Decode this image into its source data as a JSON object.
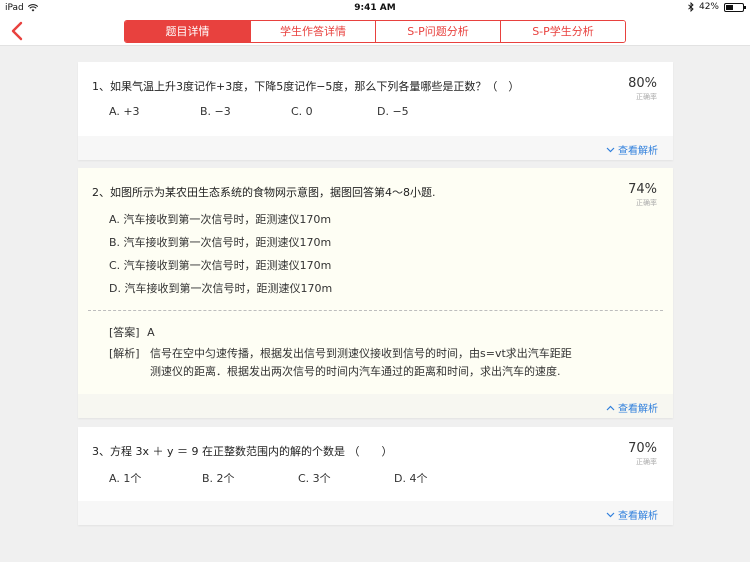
{
  "status": {
    "carrier": "iPad",
    "time": "9:41 AM",
    "battery": "42%"
  },
  "tabs": [
    {
      "label": "题目详情",
      "active": true
    },
    {
      "label": "学生作答详情",
      "active": false
    },
    {
      "label": "S-P问题分析",
      "active": false
    },
    {
      "label": "S-P学生分析",
      "active": false
    }
  ],
  "questions": [
    {
      "title": "1、如果气温上升3度记作+3度，下降5度记作−5度，那么下列各量哪些是正数？（　）",
      "rate": "80%",
      "rate_label": "正确率",
      "options": [
        "A.  +3",
        "B.  −3",
        "C.  0",
        "D.  −5"
      ],
      "toggle": "查看解析"
    },
    {
      "title": "2、如图所示为某农田生态系统的食物网示意图，据图回答第4～8小题.",
      "rate": "74%",
      "rate_label": "正确率",
      "options": [
        "A.  汽车接收到第一次信号时，距测速仪170m",
        "B.  汽车接收到第一次信号时，距测速仪170m",
        "C.  汽车接收到第一次信号时，距测速仪170m",
        "D.  汽车接收到第一次信号时，距测速仪170m"
      ],
      "answer_label": "[答案]",
      "answer": "A",
      "explain_label": "[解析]",
      "explain_line1": "信号在空中匀速传播，根据发出信号到测速仪接收到信号的时间，由s=vt求出汽车距距",
      "explain_line2": "测速仪的距离．根据发出两次信号的时间内汽车通过的距离和时间，求出汽车的速度.",
      "toggle": "查看解析"
    },
    {
      "title": "3、方程 3x ＋ y ＝ 9 在正整数范围内的解的个数是 （　　）",
      "rate": "70%",
      "rate_label": "正确率",
      "options": [
        "A.  1个",
        "B.  2个",
        "C.  3个",
        "D.  4个"
      ],
      "toggle": "查看解析"
    }
  ],
  "colors": {
    "accent": "#e8413e",
    "link": "#2f7fdc"
  }
}
